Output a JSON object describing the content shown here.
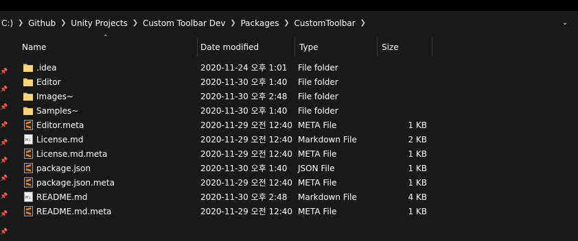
{
  "breadcrumb": {
    "items": [
      "C:)",
      "Github",
      "Unity Projects",
      "Custom Toolbar Dev",
      "Packages",
      "CustomToolbar"
    ]
  },
  "columns": {
    "name": "Name",
    "date": "Date modified",
    "type": "Type",
    "size": "Size"
  },
  "files": [
    {
      "name": ".idea",
      "date": "2020-11-24 오후 1:01",
      "type": "File folder",
      "size": "",
      "icon": "folder-icon"
    },
    {
      "name": "Editor",
      "date": "2020-11-30 오후 1:40",
      "type": "File folder",
      "size": "",
      "icon": "folder-icon"
    },
    {
      "name": "Images~",
      "date": "2020-11-30 오후 2:48",
      "type": "File folder",
      "size": "",
      "icon": "folder-icon"
    },
    {
      "name": "Samples~",
      "date": "2020-11-30 오후 1:40",
      "type": "File folder",
      "size": "",
      "icon": "folder-icon"
    },
    {
      "name": "Editor.meta",
      "date": "2020-11-29 오전 12:40",
      "type": "META File",
      "size": "1 KB",
      "icon": "sublime-file-icon"
    },
    {
      "name": "License.md",
      "date": "2020-11-29 오전 12:40",
      "type": "Markdown File",
      "size": "2 KB",
      "icon": "markdown-file-icon"
    },
    {
      "name": "License.md.meta",
      "date": "2020-11-29 오전 12:40",
      "type": "META File",
      "size": "1 KB",
      "icon": "sublime-file-icon"
    },
    {
      "name": "package.json",
      "date": "2020-11-30 오후 1:40",
      "type": "JSON File",
      "size": "1 KB",
      "icon": "sublime-file-icon"
    },
    {
      "name": "package.json.meta",
      "date": "2020-11-29 오전 12:40",
      "type": "META File",
      "size": "1 KB",
      "icon": "sublime-file-icon"
    },
    {
      "name": "README.md",
      "date": "2020-11-30 오후 2:48",
      "type": "Markdown File",
      "size": "4 KB",
      "icon": "markdown-file-icon"
    },
    {
      "name": "README.md.meta",
      "date": "2020-11-29 오전 12:40",
      "type": "META File",
      "size": "1 KB",
      "icon": "sublime-file-icon"
    }
  ],
  "colors": {
    "background": "#191919",
    "folder": "#f2c45a",
    "sublime": "#f08a24",
    "text": "#ffffff"
  }
}
